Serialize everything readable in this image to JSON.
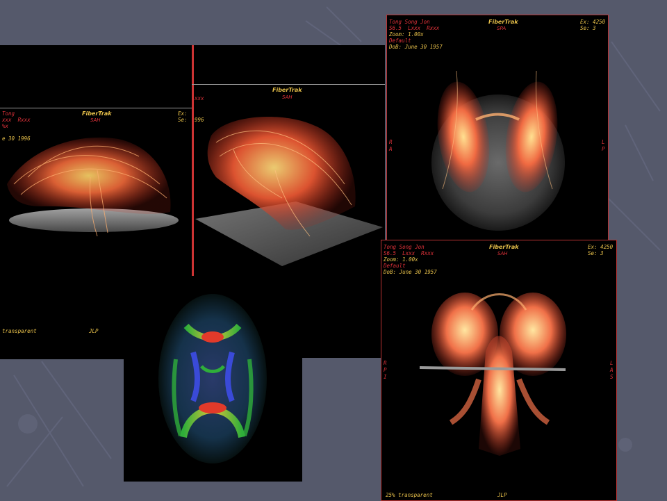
{
  "panels": {
    "left_top": {
      "title": "FiberTrak",
      "view": "SAH",
      "patient": "Tong",
      "line2": "xxx  Rxxx",
      "line3": "%x",
      "date": "e 30 1996",
      "exam": "Ex:",
      "series": "Se:",
      "bottom_left": "transparent",
      "bottom_center": "JLP"
    },
    "middle": {
      "title": "FiberTrak",
      "view": "SAH",
      "left_cut_1": "xxx",
      "left_cut_2": "996"
    },
    "right_top": {
      "patient": "Tong Song Jon",
      "line2": "S6.5  Lxxx  Rxxx",
      "zoom": "Zoom: 1.00x",
      "preset": "Default",
      "dob": "DoB: June 30 1957",
      "title": "FiberTrak",
      "view": "SPA",
      "exam": "Ex: 4250",
      "series": "Se: 3",
      "left_orient_1": "R",
      "left_orient_2": "A",
      "right_orient_1": "L",
      "right_orient_2": "P"
    },
    "right_bottom": {
      "patient": "Tong Song Jon",
      "line2": "S6.5  Lxxx  Rxxx",
      "zoom": "Zoom: 1.00x",
      "preset": "Default",
      "dob": "DoB: June 30 1957",
      "title": "FiberTrak",
      "view": "SAH",
      "exam": "Ex: 4250",
      "series": "Se: 3",
      "left_orient": [
        "R",
        "P",
        "I"
      ],
      "right_orient": [
        "L",
        "A",
        "S"
      ],
      "bottom_left": "25% transparent",
      "bottom_center": "JLP"
    }
  },
  "colors": {
    "background": "#55596b",
    "overlay_yellow": "#e8c14a",
    "overlay_red": "#e2323a",
    "fiber_orange": "#f26a3a"
  }
}
